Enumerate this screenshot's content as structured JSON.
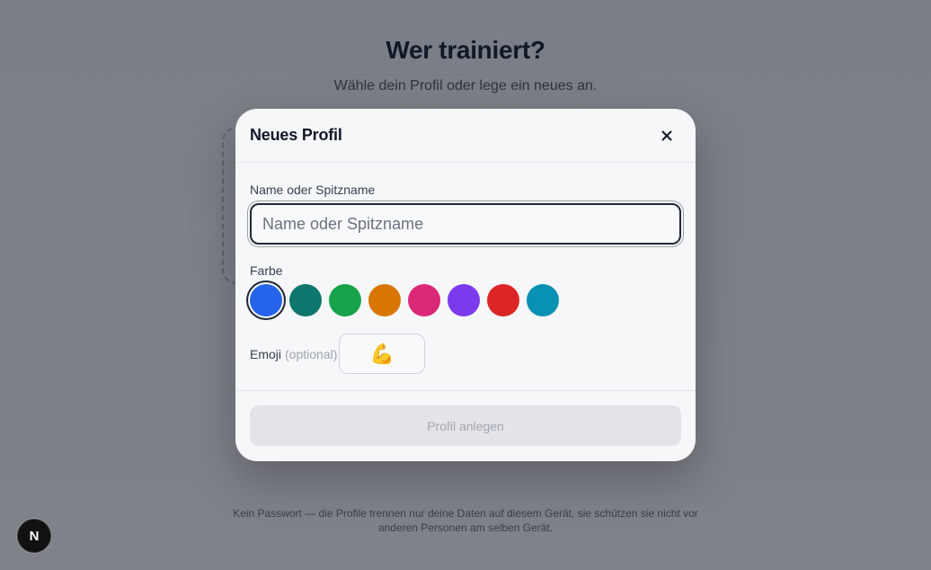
{
  "page": {
    "title": "Wer trainiert?",
    "subtitle": "Wähle dein Profil oder lege ein neues an.",
    "footer_note": "Kein Passwort — die Profile trennen nur deine Daten auf diesem Gerät, sie schützen sie nicht vor anderen Personen am selben Gerät.",
    "next_badge": "N"
  },
  "modal": {
    "title": "Neues Profil",
    "close_icon": "close-icon",
    "name_field": {
      "label": "Name oder Spitzname",
      "placeholder": "Name oder Spitzname",
      "value": ""
    },
    "color_field": {
      "label": "Farbe",
      "swatches": [
        {
          "name": "blue",
          "color": "#2563eb",
          "selected": true
        },
        {
          "name": "teal",
          "color": "#0f766e",
          "selected": false
        },
        {
          "name": "green",
          "color": "#16a34a",
          "selected": false
        },
        {
          "name": "orange",
          "color": "#d97706",
          "selected": false
        },
        {
          "name": "pink",
          "color": "#db2777",
          "selected": false
        },
        {
          "name": "purple",
          "color": "#7c3aed",
          "selected": false
        },
        {
          "name": "red",
          "color": "#dc2626",
          "selected": false
        },
        {
          "name": "cyan",
          "color": "#0891b2",
          "selected": false
        }
      ]
    },
    "emoji_field": {
      "label": "Emoji",
      "optional": "(optional)",
      "value": "💪"
    },
    "submit_label": "Profil anlegen"
  }
}
